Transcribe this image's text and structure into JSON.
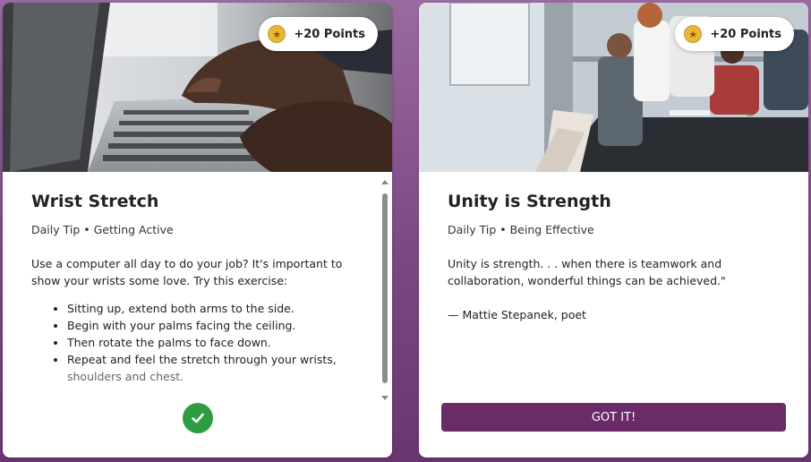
{
  "cards": [
    {
      "points_badge": "+20 Points",
      "title": "Wrist Stretch",
      "subtitle": "Daily Tip • Getting Active",
      "intro": "Use a computer all day to do your job? It's important to show your wrists some love. Try this exercise:",
      "steps": [
        "Sitting up, extend both arms to the side.",
        "Begin with your palms facing the ceiling.",
        "Then rotate the palms to face down.",
        "Repeat and feel the stretch through your wrists,",
        "shoulders and chest."
      ],
      "image": "typing-on-laptop-photo",
      "completed_icon": "checkmark-icon"
    },
    {
      "points_badge": "+20 Points",
      "title": "Unity is Strength",
      "subtitle": "Daily Tip • Being Effective",
      "quote": "Unity is strength. . . when there is teamwork and collaboration, wonderful things can be achieved.\"",
      "attribution": "— Mattie Stepanek, poet",
      "image": "office-team-meeting-photo",
      "button_label": "GOT IT!"
    }
  ],
  "colors": {
    "background": "#7d4784",
    "button": "#6a2b68",
    "check": "#2e9d3f",
    "coin": "#e8b63a"
  }
}
